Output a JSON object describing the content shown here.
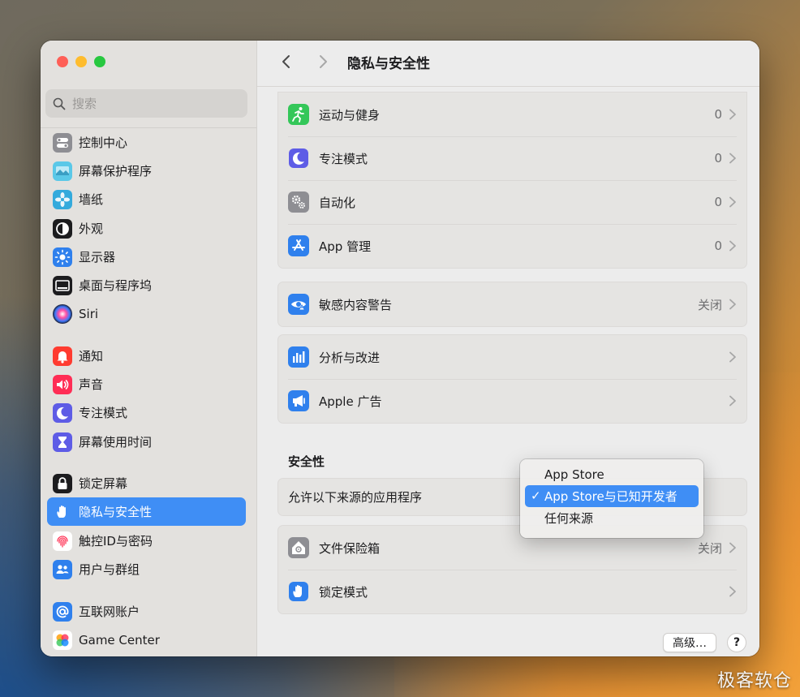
{
  "window": {
    "title": "隐私与安全性"
  },
  "search": {
    "placeholder": "搜索"
  },
  "sidebar": {
    "items": [
      {
        "label": "控制中心",
        "icon": "control-center-icon",
        "color": "#8e8e93"
      },
      {
        "label": "屏幕保护程序",
        "icon": "screensaver-icon",
        "color": "#5ac8e8"
      },
      {
        "label": "墙纸",
        "icon": "wallpaper-icon",
        "color": "#34aadc"
      },
      {
        "label": "外观",
        "icon": "appearance-icon",
        "color": "#1c1c1e"
      },
      {
        "label": "显示器",
        "icon": "display-icon",
        "color": "#2f80ed"
      },
      {
        "label": "桌面与程序坞",
        "icon": "dock-icon",
        "color": "#1c1c1e"
      },
      {
        "label": "Siri",
        "icon": "siri-icon",
        "color": "#3a3a5c"
      },
      {
        "label": "通知",
        "icon": "bell-icon",
        "color": "#ff3b30"
      },
      {
        "label": "声音",
        "icon": "speaker-icon",
        "color": "#ff2d55"
      },
      {
        "label": "专注模式",
        "icon": "moon-icon",
        "color": "#5e5ce6"
      },
      {
        "label": "屏幕使用时间",
        "icon": "hourglass-icon",
        "color": "#5e5ce6"
      },
      {
        "label": "锁定屏幕",
        "icon": "lock-icon",
        "color": "#1c1c1e"
      },
      {
        "label": "隐私与安全性",
        "icon": "hand-icon",
        "color": "#3f8ef5"
      },
      {
        "label": "触控ID与密码",
        "icon": "fingerprint-icon",
        "color": "#ffffff"
      },
      {
        "label": "用户与群组",
        "icon": "users-icon",
        "color": "#2f80ed"
      },
      {
        "label": "互联网账户",
        "icon": "at-icon",
        "color": "#2f80ed"
      },
      {
        "label": "Game Center",
        "icon": "game-center-icon",
        "color": "#ffffff"
      }
    ]
  },
  "groups": {
    "g1": [
      {
        "label": "运动与健身",
        "value": "0",
        "icon": "fitness-icon",
        "color": "#34c759"
      },
      {
        "label": "专注模式",
        "value": "0",
        "icon": "moon-icon",
        "color": "#5e5ce6"
      },
      {
        "label": "自动化",
        "value": "0",
        "icon": "gears-icon",
        "color": "#8e8e93"
      },
      {
        "label": "App 管理",
        "value": "0",
        "icon": "app-store-icon",
        "color": "#2f80ed"
      }
    ],
    "g2": [
      {
        "label": "敏感内容警告",
        "value": "关闭",
        "icon": "eye-warning-icon",
        "color": "#2f80ed"
      }
    ],
    "g3": [
      {
        "label": "分析与改进",
        "value": "",
        "icon": "chart-icon",
        "color": "#2f80ed"
      },
      {
        "label": "Apple 广告",
        "value": "",
        "icon": "megaphone-icon",
        "color": "#2f80ed"
      }
    ],
    "security_title": "安全性",
    "allow_label": "允许以下来源的应用程序",
    "g5": [
      {
        "label": "文件保险箱",
        "value": "关闭",
        "icon": "house-lock-icon",
        "color": "#8e8e93"
      },
      {
        "label": "锁定模式",
        "value": "",
        "icon": "hand-icon",
        "color": "#2f80ed"
      }
    ]
  },
  "dropdown": {
    "options": [
      "App Store",
      "App Store与已知开发者",
      "任何来源"
    ],
    "selected_index": 1,
    "check": "✓"
  },
  "buttons": {
    "advanced": "高级…",
    "help": "?"
  },
  "watermark": "极客软仓"
}
